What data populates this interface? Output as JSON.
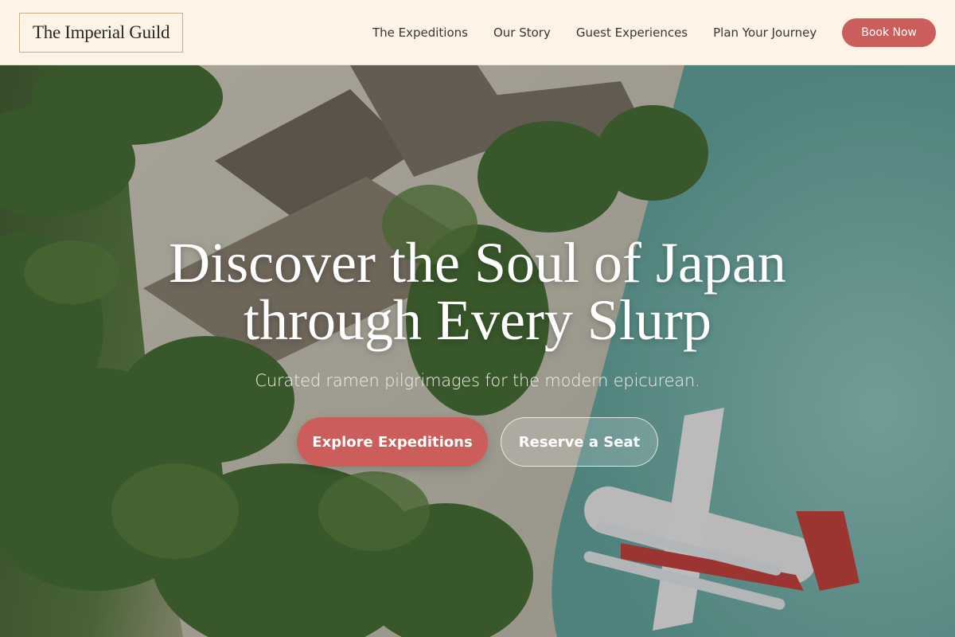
{
  "header": {
    "logo": "The Imperial Guild",
    "nav": [
      "The Expeditions",
      "Our Story",
      "Guest Experiences",
      "Plan Your Journey"
    ],
    "book_label": "Book Now"
  },
  "hero": {
    "title": "Discover the Soul of Japan through Every Slurp",
    "subtitle": "Curated ramen pilgrimages for the modern epicurean.",
    "primary_cta": "Explore Expeditions",
    "secondary_cta": "Reserve a Seat",
    "background_image": "aerial-tropical-island-seaplane-photo"
  },
  "colors": {
    "header_bg": "#fdf4e7",
    "accent": "#cb5d5b",
    "text_dark": "#3a3530"
  }
}
